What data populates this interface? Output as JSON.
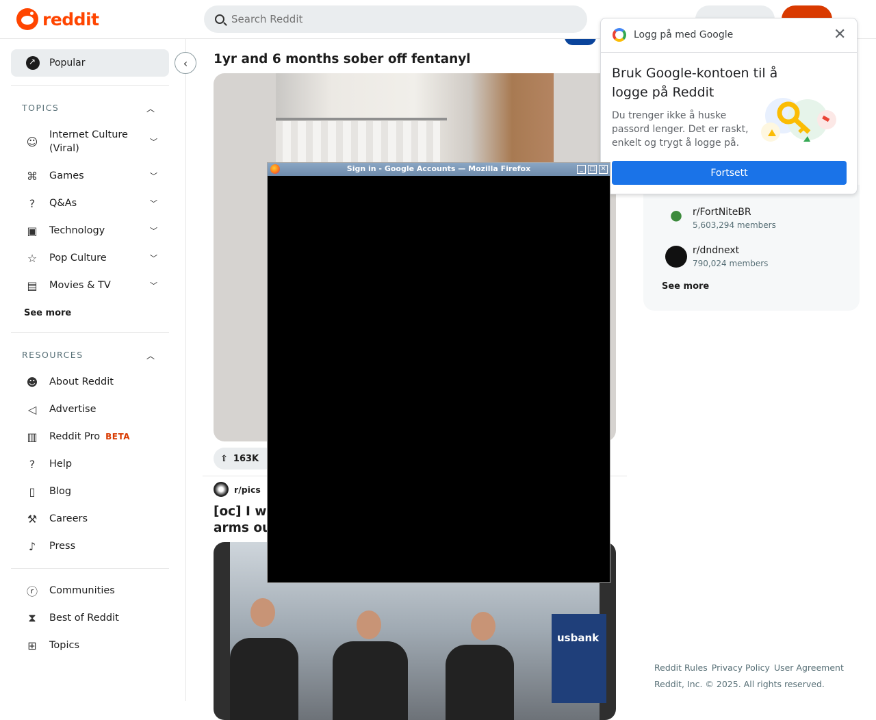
{
  "header": {
    "logo_text": "reddit",
    "search_placeholder": "Search Reddit"
  },
  "sidebar": {
    "popular_label": "Popular",
    "topics_heading": "TOPICS",
    "topics": [
      {
        "label": "Internet Culture (Viral)",
        "icon": "smile-icon"
      },
      {
        "label": "Games",
        "icon": "gamepad-icon"
      },
      {
        "label": "Q&As",
        "icon": "question-icon"
      },
      {
        "label": "Technology",
        "icon": "chip-icon"
      },
      {
        "label": "Pop Culture",
        "icon": "star-icon"
      },
      {
        "label": "Movies & TV",
        "icon": "clapper-icon"
      }
    ],
    "see_more": "See more",
    "resources_heading": "RESOURCES",
    "resources": [
      {
        "label": "About Reddit",
        "icon": "reddit-icon"
      },
      {
        "label": "Advertise",
        "icon": "megaphone-icon"
      },
      {
        "label": "Reddit Pro",
        "badge": "BETA",
        "icon": "chart-icon"
      },
      {
        "label": "Help",
        "icon": "help-icon"
      },
      {
        "label": "Blog",
        "icon": "book-icon"
      },
      {
        "label": "Careers",
        "icon": "wrench-icon"
      },
      {
        "label": "Press",
        "icon": "mic-icon"
      }
    ],
    "bottom": [
      {
        "label": "Communities",
        "icon": "communities-icon"
      },
      {
        "label": "Best of Reddit",
        "icon": "hourglass-icon"
      },
      {
        "label": "Topics",
        "icon": "grid-icon"
      }
    ]
  },
  "feed": {
    "post1_title": "1yr and 6 months sober off fentanyl",
    "post1_votes": "163K",
    "post2_subreddit": "r/pics",
    "post2_title_line1": "[oc] I wi",
    "post2_title_line2": "arms ou",
    "usbank_text": "usbank"
  },
  "right": {
    "communities": [
      {
        "name": "r/FortNiteBR",
        "members": "5,603,294 members"
      },
      {
        "name": "r/dndnext",
        "members": "790,024 members"
      }
    ],
    "see_more": "See more",
    "footer_links": [
      "Reddit Rules",
      "Privacy Policy",
      "User Agreement"
    ],
    "copyright": "Reddit, Inc. © 2025. All rights reserved."
  },
  "google": {
    "header": "Logg på med Google",
    "title": "Bruk Google-kontoen til å logge på Reddit",
    "description": "Du trenger ikke å huske passord lenger. Det er raskt, enkelt og trygt å logge på.",
    "button": "Fortsett"
  },
  "firefox": {
    "title": "Sign in - Google Accounts — Mozilla Firefox"
  },
  "colors": {
    "reddit_orange": "#ff4500",
    "google_blue": "#1a73e8",
    "beta_red": "#d93a00"
  }
}
